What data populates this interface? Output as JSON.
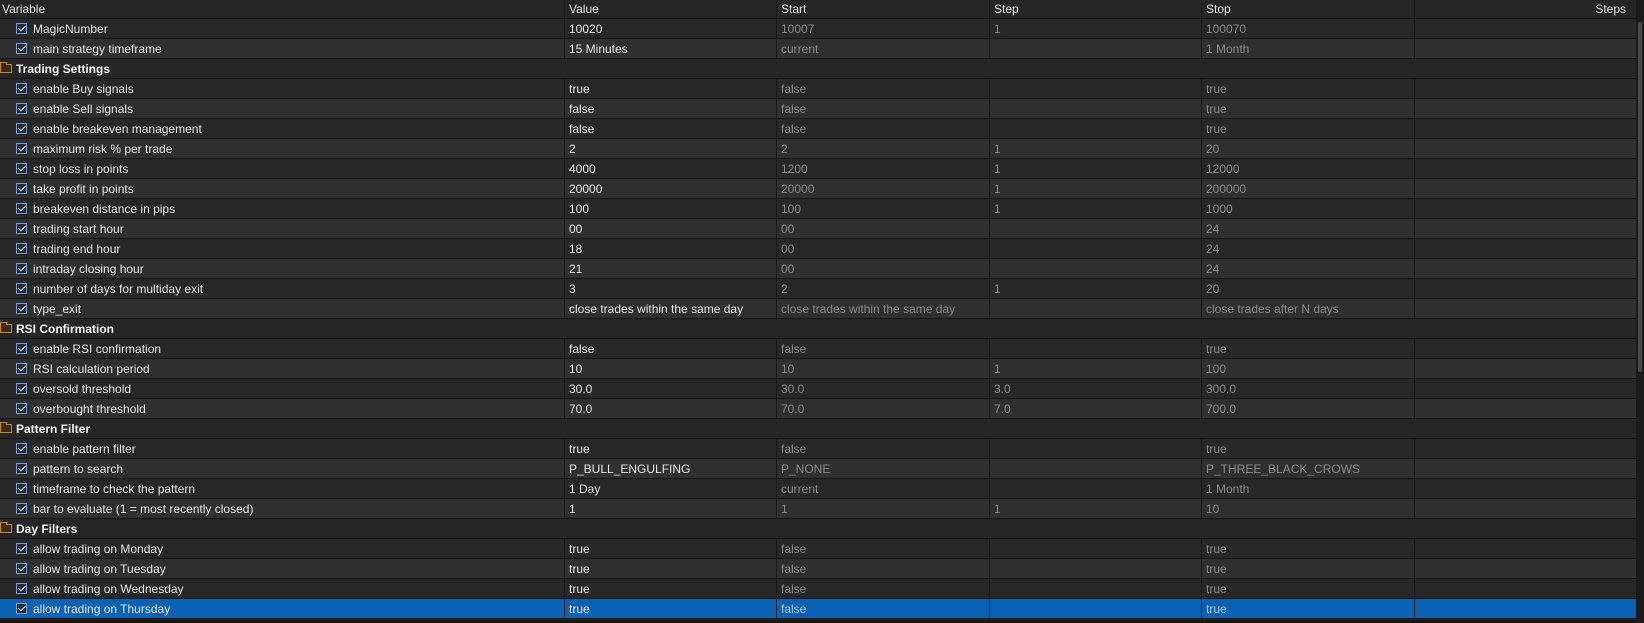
{
  "columns": {
    "variable": "Variable",
    "value": "Value",
    "start": "Start",
    "step": "Step",
    "stop": "Stop",
    "steps": "Steps"
  },
  "rows": [
    {
      "type": "param",
      "name": "MagicNumber",
      "value": "10020",
      "start": "10007",
      "step": "1",
      "stop": "100070",
      "steps": ""
    },
    {
      "type": "param",
      "name": "main strategy timeframe",
      "value": "15 Minutes",
      "start": "current",
      "step": "",
      "stop": "1 Month",
      "steps": ""
    },
    {
      "type": "group",
      "name": "Trading Settings"
    },
    {
      "type": "param",
      "name": "enable Buy signals",
      "value": "true",
      "start": "false",
      "step": "",
      "stop": "true",
      "steps": ""
    },
    {
      "type": "param",
      "name": "enable Sell signals",
      "value": "false",
      "start": "false",
      "step": "",
      "stop": "true",
      "steps": ""
    },
    {
      "type": "param",
      "name": "enable breakeven management",
      "value": "false",
      "start": "false",
      "step": "",
      "stop": "true",
      "steps": ""
    },
    {
      "type": "param",
      "name": "maximum risk % per trade",
      "value": "2",
      "start": "2",
      "step": "1",
      "stop": "20",
      "steps": ""
    },
    {
      "type": "param",
      "name": "stop loss in points",
      "value": "4000",
      "start": "1200",
      "step": "1",
      "stop": "12000",
      "steps": ""
    },
    {
      "type": "param",
      "name": "take profit in points",
      "value": "20000",
      "start": "20000",
      "step": "1",
      "stop": "200000",
      "steps": ""
    },
    {
      "type": "param",
      "name": "breakeven distance in pips",
      "value": "100",
      "start": "100",
      "step": "1",
      "stop": "1000",
      "steps": ""
    },
    {
      "type": "param",
      "name": "trading start hour",
      "value": "00",
      "start": "00",
      "step": "",
      "stop": "24",
      "steps": ""
    },
    {
      "type": "param",
      "name": "trading end hour",
      "value": "18",
      "start": "00",
      "step": "",
      "stop": "24",
      "steps": ""
    },
    {
      "type": "param",
      "name": "intraday closing hour",
      "value": "21",
      "start": "00",
      "step": "",
      "stop": "24",
      "steps": ""
    },
    {
      "type": "param",
      "name": "number of days for multiday exit",
      "value": "3",
      "start": "2",
      "step": "1",
      "stop": "20",
      "steps": ""
    },
    {
      "type": "param",
      "name": "type_exit",
      "value": "close trades within the same day",
      "start": "close trades within the same day",
      "step": "",
      "stop": "close trades after N days",
      "steps": ""
    },
    {
      "type": "group",
      "name": "RSI Confirmation"
    },
    {
      "type": "param",
      "name": "enable RSI confirmation",
      "value": "false",
      "start": "false",
      "step": "",
      "stop": "true",
      "steps": ""
    },
    {
      "type": "param",
      "name": "RSI calculation period",
      "value": "10",
      "start": "10",
      "step": "1",
      "stop": "100",
      "steps": ""
    },
    {
      "type": "param",
      "name": "oversold threshold",
      "value": "30.0",
      "start": "30.0",
      "step": "3.0",
      "stop": "300.0",
      "steps": ""
    },
    {
      "type": "param",
      "name": "overbought threshold",
      "value": "70.0",
      "start": "70.0",
      "step": "7.0",
      "stop": "700.0",
      "steps": ""
    },
    {
      "type": "group",
      "name": "Pattern Filter"
    },
    {
      "type": "param",
      "name": "enable pattern filter",
      "value": "true",
      "start": "false",
      "step": "",
      "stop": "true",
      "steps": ""
    },
    {
      "type": "param",
      "name": "pattern to search",
      "value": "P_BULL_ENGULFING",
      "start": "P_NONE",
      "step": "",
      "stop": "P_THREE_BLACK_CROWS",
      "steps": ""
    },
    {
      "type": "param",
      "name": "timeframe to check the pattern",
      "value": "1 Day",
      "start": "current",
      "step": "",
      "stop": "1 Month",
      "steps": ""
    },
    {
      "type": "param",
      "name": "bar to evaluate (1 = most recently closed)",
      "value": "1",
      "start": "1",
      "step": "1",
      "stop": "10",
      "steps": ""
    },
    {
      "type": "group",
      "name": "Day Filters"
    },
    {
      "type": "param",
      "name": "allow trading on Monday",
      "value": "true",
      "start": "false",
      "step": "",
      "stop": "true",
      "steps": ""
    },
    {
      "type": "param",
      "name": "allow trading on Tuesday",
      "value": "true",
      "start": "false",
      "step": "",
      "stop": "true",
      "steps": ""
    },
    {
      "type": "param",
      "name": "allow trading on Wednesday",
      "value": "true",
      "start": "false",
      "step": "",
      "stop": "true",
      "steps": ""
    },
    {
      "type": "param",
      "name": "allow trading on Thursday",
      "value": "true",
      "start": "false",
      "step": "",
      "stop": "true",
      "steps": "",
      "selected": true
    }
  ]
}
